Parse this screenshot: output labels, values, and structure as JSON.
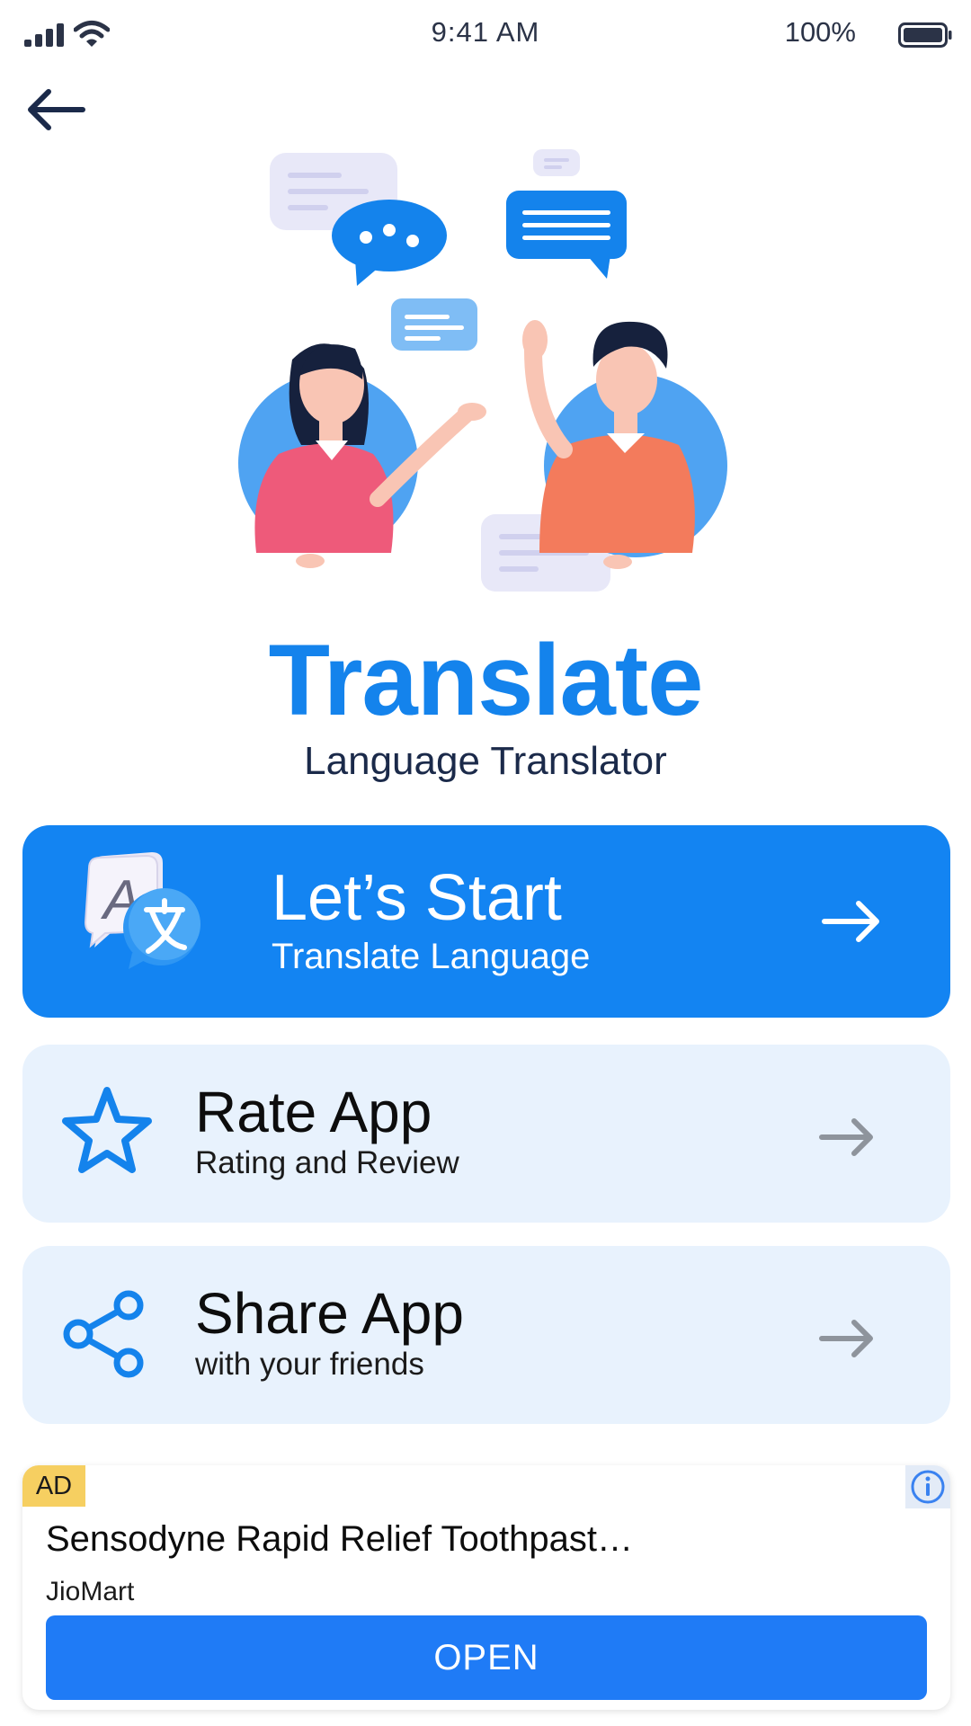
{
  "status_bar": {
    "time": "9:41 AM",
    "battery": "100%"
  },
  "nav": {
    "back_icon": "arrow-left-icon"
  },
  "hero": {
    "illustration": "two-people-chatting-illustration"
  },
  "app": {
    "title": "Translate",
    "subtitle": "Language Translator"
  },
  "cards": {
    "start": {
      "title": "Let’s Start",
      "subtitle": "Translate Language",
      "icon": "translate-icon"
    },
    "rate": {
      "title": "Rate App",
      "subtitle": "Rating and Review",
      "icon": "star-icon"
    },
    "share": {
      "title": "Share App",
      "subtitle": "with your friends",
      "icon": "share-icon"
    }
  },
  "ad": {
    "badge": "AD",
    "title": "Sensodyne Rapid Relief Toothpast…",
    "advertiser": "JioMart",
    "cta": "OPEN"
  },
  "colors": {
    "accent": "#1384f2",
    "card_light": "#e8f2fd",
    "ad_badge": "#f6cf61",
    "ad_button": "#1f7bf6"
  }
}
